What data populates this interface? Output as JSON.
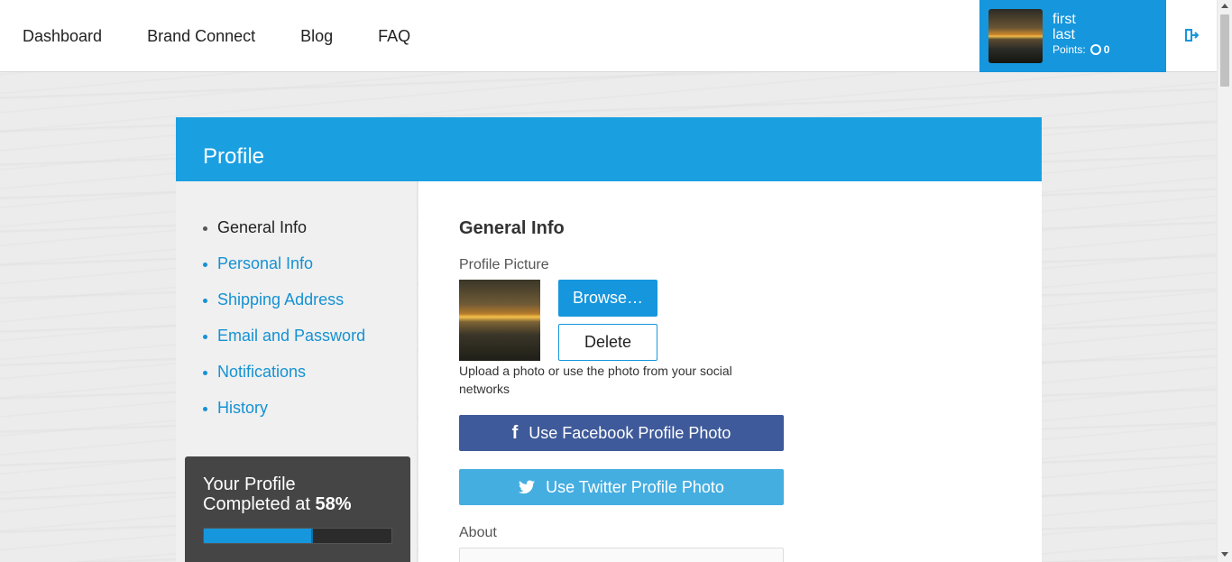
{
  "nav": {
    "items": [
      "Dashboard",
      "Brand Connect",
      "Blog",
      "FAQ"
    ]
  },
  "user": {
    "first": "first",
    "last": "last",
    "points_label": "Points:",
    "points_value": "0",
    "avatar_icon": "user-avatar-sunset",
    "logout_icon": "logout-icon"
  },
  "profile": {
    "title": "Profile",
    "menu": [
      {
        "label": "General Info",
        "active": true
      },
      {
        "label": "Personal Info",
        "active": false
      },
      {
        "label": "Shipping Address",
        "active": false
      },
      {
        "label": "Email and Password",
        "active": false
      },
      {
        "label": "Notifications",
        "active": false
      },
      {
        "label": "History",
        "active": false
      }
    ],
    "completion": {
      "line1": "Your Profile",
      "line2_prefix": "Completed at",
      "percent_text": "58%",
      "percent": 58
    }
  },
  "general": {
    "title": "General Info",
    "picture_label": "Profile Picture",
    "browse_label": "Browse…",
    "delete_label": "Delete",
    "help_text": "Upload a photo or use the photo from your social networks",
    "facebook_label": "Use Facebook Profile Photo",
    "twitter_label": "Use Twitter Profile Photo",
    "about_label": "About"
  },
  "colors": {
    "accent": "#1596dd",
    "facebook": "#3f5a9a",
    "twitter": "#45aee1"
  }
}
